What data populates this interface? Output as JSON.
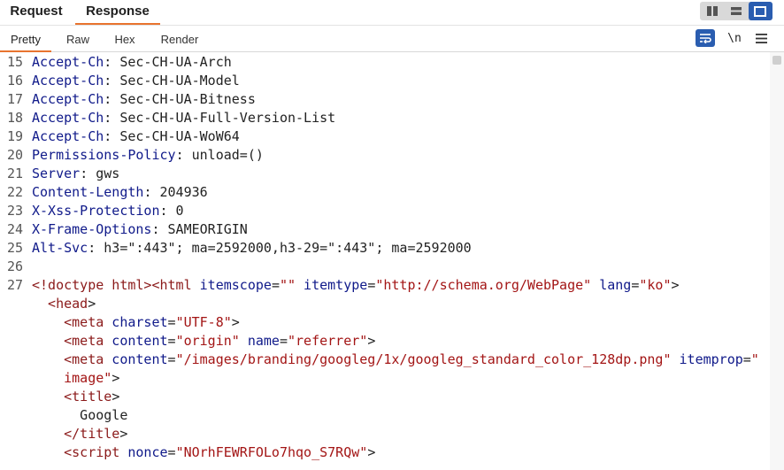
{
  "tabs": [
    {
      "label": "Request",
      "active": false
    },
    {
      "label": "Response",
      "active": true
    }
  ],
  "subtabs": [
    {
      "label": "Pretty",
      "active": true
    },
    {
      "label": "Raw",
      "active": false
    },
    {
      "label": "Hex",
      "active": false
    },
    {
      "label": "Render",
      "active": false
    }
  ],
  "toolbar": {
    "newline_label": "\\n",
    "layout_icons": [
      "split-columns-icon",
      "split-rows-icon",
      "single-pane-icon"
    ],
    "accent": "#2a5db0",
    "tab_underline": "#e8742f"
  },
  "editor": {
    "lines": [
      {
        "n": "15",
        "tokens": [
          {
            "t": "Accept-Ch",
            "c": "hk"
          },
          {
            "t": ": Sec-CH-UA-Arch",
            "c": "hv"
          }
        ]
      },
      {
        "n": "16",
        "tokens": [
          {
            "t": "Accept-Ch",
            "c": "hk"
          },
          {
            "t": ": Sec-CH-UA-Model",
            "c": "hv"
          }
        ]
      },
      {
        "n": "17",
        "tokens": [
          {
            "t": "Accept-Ch",
            "c": "hk"
          },
          {
            "t": ": Sec-CH-UA-Bitness",
            "c": "hv"
          }
        ]
      },
      {
        "n": "18",
        "tokens": [
          {
            "t": "Accept-Ch",
            "c": "hk"
          },
          {
            "t": ": Sec-CH-UA-Full-Version-List",
            "c": "hv"
          }
        ]
      },
      {
        "n": "19",
        "tokens": [
          {
            "t": "Accept-Ch",
            "c": "hk"
          },
          {
            "t": ": Sec-CH-UA-WoW64",
            "c": "hv"
          }
        ]
      },
      {
        "n": "20",
        "tokens": [
          {
            "t": "Permissions-Policy",
            "c": "hk"
          },
          {
            "t": ": unload=()",
            "c": "hv"
          }
        ]
      },
      {
        "n": "21",
        "tokens": [
          {
            "t": "Server",
            "c": "hk"
          },
          {
            "t": ": gws",
            "c": "hv"
          }
        ]
      },
      {
        "n": "22",
        "tokens": [
          {
            "t": "Content-Length",
            "c": "hk"
          },
          {
            "t": ": 204936",
            "c": "hv"
          }
        ]
      },
      {
        "n": "23",
        "tokens": [
          {
            "t": "X-Xss-Protection",
            "c": "hk"
          },
          {
            "t": ": 0",
            "c": "hv"
          }
        ]
      },
      {
        "n": "24",
        "tokens": [
          {
            "t": "X-Frame-Options",
            "c": "hk"
          },
          {
            "t": ": SAMEORIGIN",
            "c": "hv"
          }
        ]
      },
      {
        "n": "25",
        "tokens": [
          {
            "t": "Alt-Svc",
            "c": "hk"
          },
          {
            "t": ": h3=\":443\"; ma=2592000,h3-29=\":443\"; ma=2592000",
            "c": "hv"
          }
        ]
      },
      {
        "n": "26",
        "tokens": []
      },
      {
        "n": "27",
        "tokens": [
          {
            "t": "<!doctype html>",
            "c": "tag"
          },
          {
            "t": "<html",
            "c": "tag"
          },
          {
            "t": " itemscope",
            "c": "attr"
          },
          {
            "t": "=",
            "c": "pun"
          },
          {
            "t": "\"\"",
            "c": "str"
          },
          {
            "t": " itemtype",
            "c": "attr"
          },
          {
            "t": "=",
            "c": "pun"
          },
          {
            "t": "\"http://schema.org/WebPage\"",
            "c": "str"
          },
          {
            "t": " lang",
            "c": "attr"
          },
          {
            "t": "=",
            "c": "pun"
          },
          {
            "t": "\"ko\"",
            "c": "str"
          },
          {
            "t": ">",
            "c": "pun"
          }
        ]
      },
      {
        "n": "",
        "tokens": [
          {
            "t": "  <head",
            "c": "tag"
          },
          {
            "t": ">",
            "c": "pun"
          }
        ]
      },
      {
        "n": "",
        "tokens": [
          {
            "t": "    <meta",
            "c": "tag"
          },
          {
            "t": " charset",
            "c": "attr"
          },
          {
            "t": "=",
            "c": "pun"
          },
          {
            "t": "\"UTF-8\"",
            "c": "str"
          },
          {
            "t": ">",
            "c": "pun"
          }
        ]
      },
      {
        "n": "",
        "tokens": [
          {
            "t": "    <meta",
            "c": "tag"
          },
          {
            "t": " content",
            "c": "attr"
          },
          {
            "t": "=",
            "c": "pun"
          },
          {
            "t": "\"origin\"",
            "c": "str"
          },
          {
            "t": " name",
            "c": "attr"
          },
          {
            "t": "=",
            "c": "pun"
          },
          {
            "t": "\"referrer\"",
            "c": "str"
          },
          {
            "t": ">",
            "c": "pun"
          }
        ]
      },
      {
        "n": "",
        "tokens": [
          {
            "t": "    <meta",
            "c": "tag"
          },
          {
            "t": " content",
            "c": "attr"
          },
          {
            "t": "=",
            "c": "pun"
          },
          {
            "t": "\"/images/branding/googleg/1x/googleg_standard_color_128dp.png\"",
            "c": "str"
          },
          {
            "t": " itemprop",
            "c": "attr"
          },
          {
            "t": "=",
            "c": "pun"
          },
          {
            "t": "\"",
            "c": "str"
          }
        ]
      },
      {
        "n": "",
        "tokens": [
          {
            "t": "    image\"",
            "c": "str"
          },
          {
            "t": ">",
            "c": "pun"
          }
        ]
      },
      {
        "n": "",
        "tokens": [
          {
            "t": "    <title",
            "c": "tag"
          },
          {
            "t": ">",
            "c": "pun"
          }
        ]
      },
      {
        "n": "",
        "tokens": [
          {
            "t": "      Google",
            "c": "hv"
          }
        ]
      },
      {
        "n": "",
        "tokens": [
          {
            "t": "    </title",
            "c": "tag"
          },
          {
            "t": ">",
            "c": "pun"
          }
        ]
      },
      {
        "n": "",
        "tokens": [
          {
            "t": "    <script",
            "c": "tag"
          },
          {
            "t": " nonce",
            "c": "attr"
          },
          {
            "t": "=",
            "c": "pun"
          },
          {
            "t": "\"NOrhFEWRFOLo7hqo_S7RQw\"",
            "c": "str"
          },
          {
            "t": ">",
            "c": "pun"
          }
        ]
      }
    ]
  }
}
